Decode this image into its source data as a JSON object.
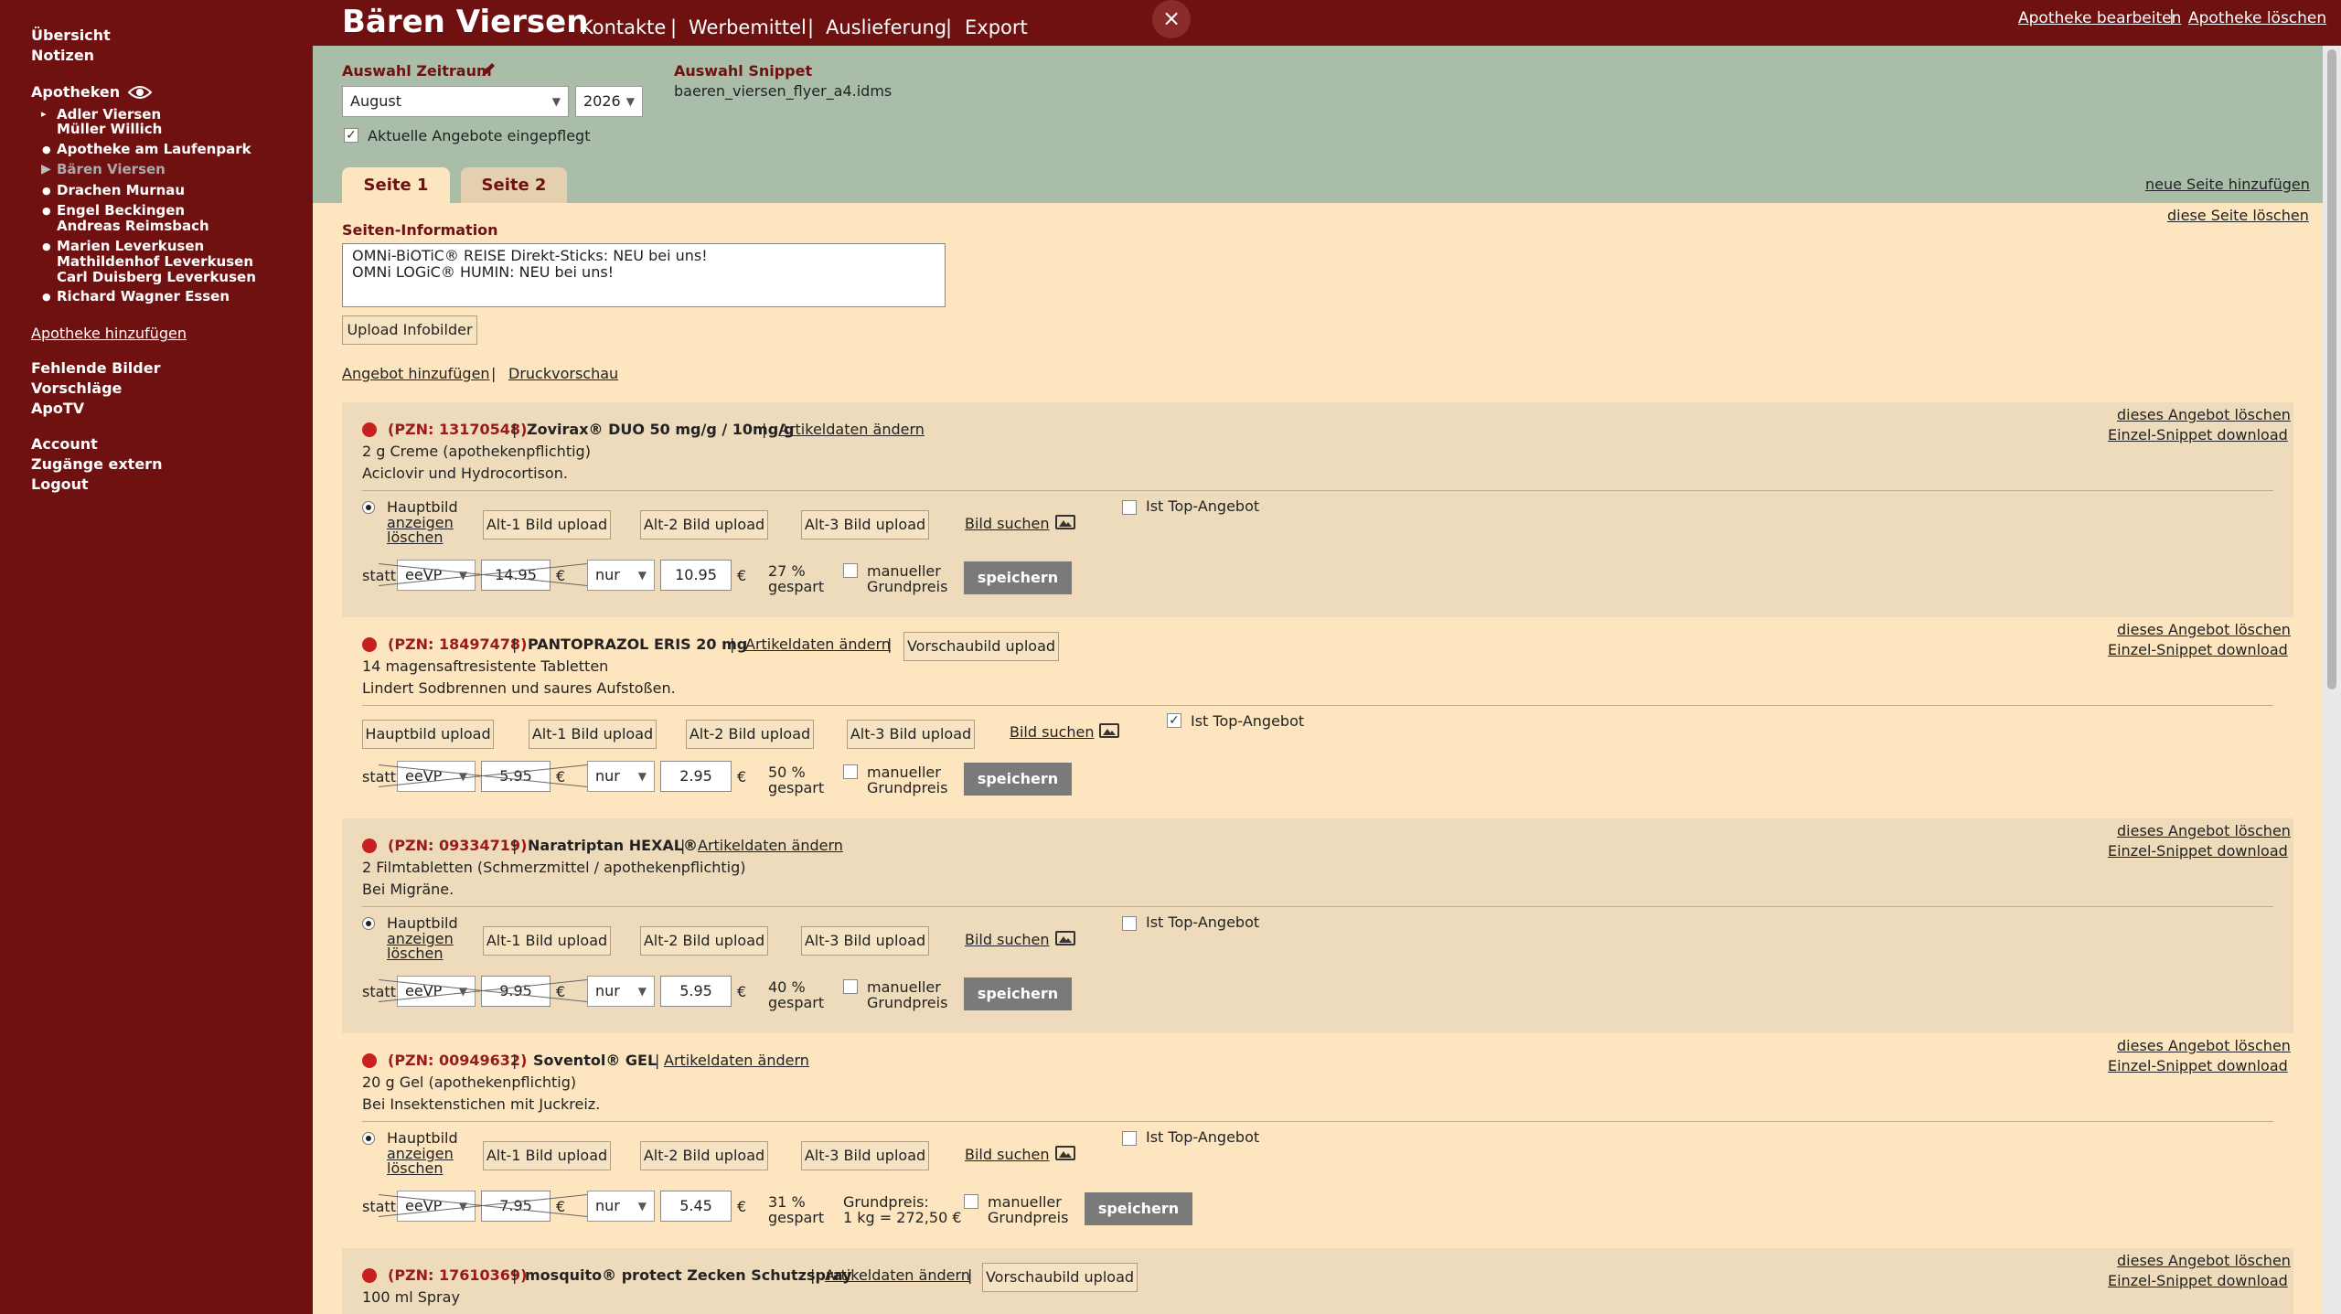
{
  "sidebar": {
    "uebersicht": "Übersicht",
    "notizen": "Notizen",
    "apotheken": "Apotheken",
    "apotheken_list": [
      {
        "name": "Adler Viersen",
        "sub": "Müller Willich"
      },
      {
        "name": "Apotheke am Laufenpark"
      },
      {
        "name": "Bären Viersen"
      },
      {
        "name": "Drachen Murnau"
      },
      {
        "name": "Engel Beckingen",
        "sub": "Andreas Reimsbach"
      },
      {
        "name": "Marien Leverkusen",
        "sub": "Mathildenhof Leverkusen",
        "sub2": "Carl Duisberg Leverkusen"
      },
      {
        "name": "Richard Wagner Essen"
      }
    ],
    "add_apotheke": "Apotheke hinzufügen",
    "fehlende_bilder": "Fehlende Bilder",
    "vorschlaege": "Vorschläge",
    "apotv": "ApoTV",
    "account": "Account",
    "zugaenge": "Zugänge extern",
    "logout": "Logout"
  },
  "header": {
    "title": "Bären Viersen",
    "nav": [
      "Kontakte",
      "Werbemittel",
      "Auslieferung",
      "Export"
    ],
    "separator": "|",
    "edit_link": "Apotheke bearbeiten",
    "delete_link": "Apotheke löschen",
    "close_symbol": "×"
  },
  "filter": {
    "zeitraum_label": "Auswahl Zeitraum",
    "month": "August",
    "year": "2026",
    "snippet_label": "Auswahl Snippet",
    "snippet_value": "baeren_viersen_flyer_a4.idms",
    "angebote_label": "Aktuelle Angebote eingepflegt"
  },
  "tabs": [
    "Seite 1",
    "Seite 2"
  ],
  "page_actions": {
    "new_page": "neue Seite hinzufügen",
    "delete_page": "diese Seite löschen"
  },
  "page_info": {
    "label": "Seiten-Information",
    "text": "OMNi-BiOTiC® REISE Direkt-Sticks: NEU bei uns!\nOMNi LOGiC® HUMIN: NEU bei uns!",
    "upload_button": "Upload Infobilder",
    "add_offer": "Angebot hinzufügen",
    "print_preview": "Druckvorschau"
  },
  "labels": {
    "delete_offer": "dieses Angebot löschen",
    "snippet_download": "Einzel-Snippet download",
    "edit_article": "Artikeldaten ändern",
    "hauptbild": "Hauptbild",
    "anzeigen": "anzeigen",
    "loeschen": "löschen",
    "hauptbild_upload": "Hauptbild upload",
    "alt1": "Alt-1 Bild upload",
    "alt2": "Alt-2 Bild upload",
    "alt3": "Alt-3 Bild upload",
    "bild_suchen": "Bild suchen",
    "top_offer": "Ist Top-Angebot",
    "statt": "statt",
    "price_type": "eeVP",
    "euro": "€",
    "nur": "nur",
    "gespart": "gespart",
    "manueller": "manueller",
    "grundpreis": "Grundpreis",
    "save": "speichern",
    "vorschaubild": "Vorschaubild upload"
  },
  "offers": [
    {
      "pzn": "(PZN: 13170548)",
      "name": "Zovirax® DUO 50 mg/g / 10mg/g",
      "desc1": "2 g Creme (apothekenpflichtig)",
      "desc2": "Aciclovir und Hydrocortison.",
      "old_price": "14.95",
      "new_price": "10.95",
      "saved": "27 %",
      "top": false
    },
    {
      "pzn": "(PZN: 18497478)",
      "name": "PANTOPRAZOL ERIS 20 mg",
      "desc1": "14 magensaftresistente Tabletten",
      "desc2": "Lindert Sodbrennen und saures Aufstoßen.",
      "old_price": "5.95",
      "new_price": "2.95",
      "saved": "50 %",
      "top": true
    },
    {
      "pzn": "(PZN: 09334719)",
      "name": "Naratriptan HEXAL®",
      "desc1": "2 Filmtabletten (Schmerzmittel / apothekenpflichtig)",
      "desc2": "Bei Migräne.",
      "old_price": "9.95",
      "new_price": "5.95",
      "saved": "40 %",
      "top": false
    },
    {
      "pzn": "(PZN: 00949632)",
      "name": "Soventol® GEL",
      "desc1": "20 g Gel (apothekenpflichtig)",
      "desc2": "Bei Insektenstichen mit Juckreiz.",
      "old_price": "7.95",
      "new_price": "5.45",
      "saved": "31 %",
      "grundpreis_label": "Grundpreis:",
      "grundpreis_value": "1 kg = 272,50 €",
      "top": false
    },
    {
      "pzn": "(PZN: 17610369)",
      "name": "mosquito® protect Zecken Schutzspray",
      "desc1": "100 ml Spray"
    }
  ],
  "colors": {
    "brand": "#6e1110",
    "filter_bg": "#a9bda9",
    "offer_bg_dark": "#eedbbb",
    "offer_bg_light": "#fde5c0",
    "status_dot": "#c8201e"
  }
}
